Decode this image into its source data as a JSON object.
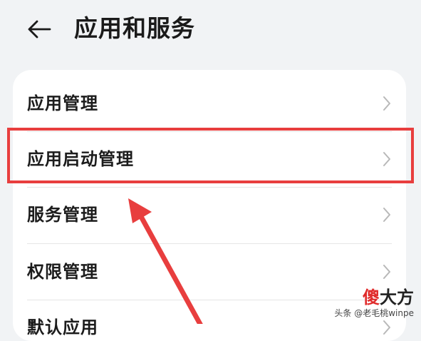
{
  "header": {
    "title": "应用和服务",
    "back_icon": "arrow-left-icon"
  },
  "menu": {
    "items": [
      {
        "label": "应用管理",
        "icon": "chevron-right-icon"
      },
      {
        "label": "应用启动管理",
        "icon": "chevron-right-icon",
        "highlighted": true
      },
      {
        "label": "服务管理",
        "icon": "chevron-right-icon"
      },
      {
        "label": "权限管理",
        "icon": "chevron-right-icon"
      },
      {
        "label": "默认应用",
        "icon": "chevron-right-icon"
      }
    ]
  },
  "annotation": {
    "highlight_color": "#e83e3e",
    "arrow_color": "#e83e3e"
  },
  "watermark": {
    "logo_char1": "傻",
    "logo_char2": "大方",
    "credit": "头条 @老毛桃winpe"
  },
  "colors": {
    "background": "#f1f3f5",
    "card": "#ffffff"
  }
}
